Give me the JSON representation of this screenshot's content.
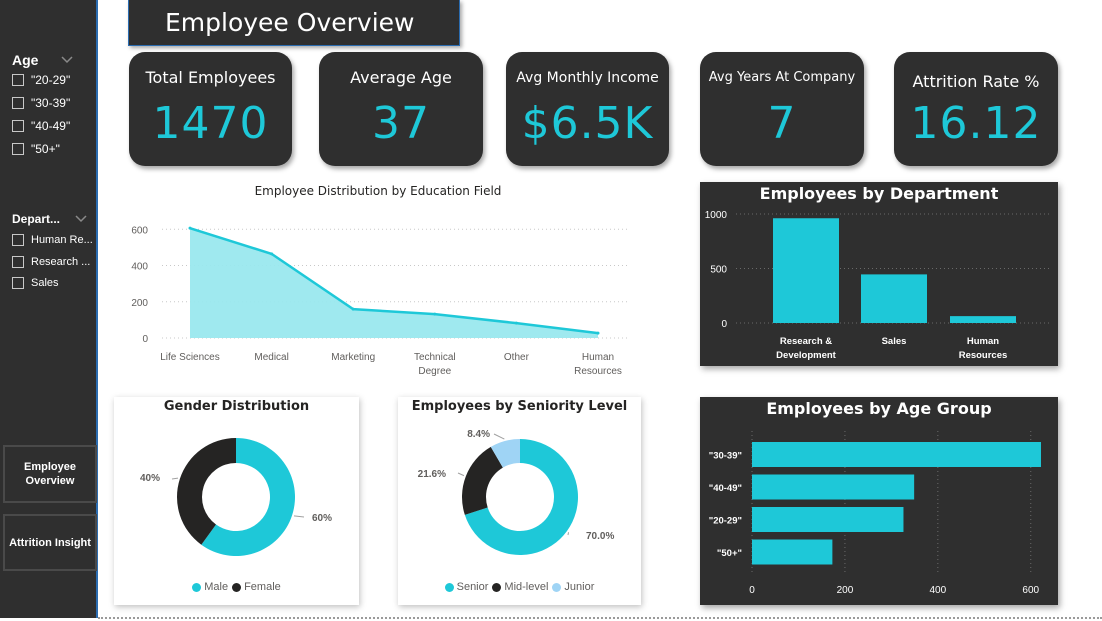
{
  "page_title": "Employee Overview",
  "sidebar": {
    "age_slicer": {
      "title": "Age",
      "options": [
        "\"20-29\"",
        "\"30-39\"",
        "\"40-49\"",
        "\"50+\""
      ]
    },
    "dept_slicer": {
      "title": "Depart...",
      "options": [
        "Human Re...",
        "Research ...",
        "Sales"
      ]
    },
    "nav": {
      "overview": "Employee Overview",
      "attrition": "Attrition Insight"
    }
  },
  "kpis": {
    "total_employees": {
      "label": "Total Employees",
      "value": "1470"
    },
    "average_age": {
      "label": "Average Age",
      "value": "37"
    },
    "avg_monthly_income": {
      "label": "Avg Monthly Income",
      "value": "$6.5K"
    },
    "avg_years": {
      "label": "Avg Years At Company",
      "value": "7"
    },
    "attrition_rate": {
      "label": "Attrition Rate %",
      "value": "16.12"
    }
  },
  "colors": {
    "accent": "#1ec8d8",
    "dark": "#252423",
    "light_blue": "#9fd4f5",
    "panel": "#2f2f2f"
  },
  "chart_data": [
    {
      "type": "area",
      "title": "Employee Distribution by Education Field",
      "categories": [
        "Life Sciences",
        "Medical",
        "Marketing",
        "Technical Degree",
        "Other",
        "Human Resources"
      ],
      "category_labels": [
        [
          "Life Sciences"
        ],
        [
          "Medical"
        ],
        [
          "Marketing"
        ],
        [
          "Technical",
          "Degree"
        ],
        [
          "Other"
        ],
        [
          "Human",
          "Resources"
        ]
      ],
      "values": [
        606,
        464,
        159,
        132,
        82,
        27
      ],
      "yticks": [
        0,
        200,
        400,
        600
      ],
      "ylim": [
        0,
        640
      ],
      "grid": true
    },
    {
      "type": "bar",
      "title": "Employees by Department",
      "categories": [
        "Research & Development",
        "Sales",
        "Human Resources"
      ],
      "category_labels": [
        [
          "Research &",
          "Development"
        ],
        [
          "Sales"
        ],
        [
          "Human",
          "Resources"
        ]
      ],
      "values": [
        961,
        446,
        63
      ],
      "yticks": [
        0,
        500,
        1000
      ],
      "ylim": [
        0,
        1000
      ],
      "grid": true
    },
    {
      "type": "pie",
      "title": "Gender Distribution",
      "labels": [
        "Male",
        "Female"
      ],
      "values": [
        60,
        40
      ],
      "value_labels": [
        "60%",
        "40%"
      ],
      "colors": [
        "#1ec8d8",
        "#252423"
      ]
    },
    {
      "type": "pie",
      "title": "Employees by Seniority Level",
      "labels": [
        "Senior",
        "Mid-level",
        "Junior"
      ],
      "values": [
        70.0,
        21.6,
        8.4
      ],
      "value_labels": [
        "70.0%",
        "21.6%",
        "8.4%"
      ],
      "colors": [
        "#1ec8d8",
        "#252423",
        "#9fd4f5"
      ]
    },
    {
      "type": "bar",
      "orientation": "horizontal",
      "title": "Employees by Age Group",
      "categories": [
        "\"30-39\"",
        "\"40-49\"",
        "\"20-29\"",
        "\"50+\""
      ],
      "values": [
        622,
        349,
        326,
        173
      ],
      "xticks": [
        0,
        200,
        400,
        600
      ],
      "xlim": [
        0,
        650
      ],
      "grid": true
    }
  ]
}
